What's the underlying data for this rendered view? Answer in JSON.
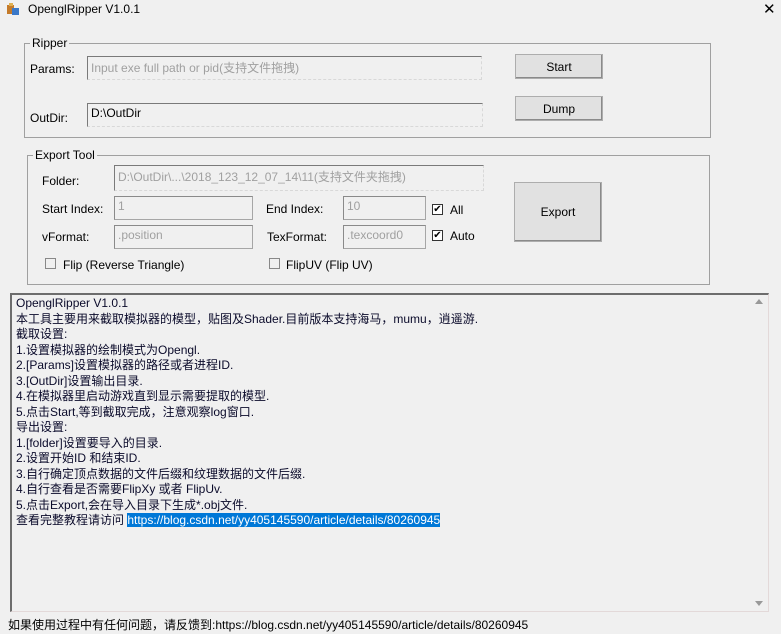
{
  "window": {
    "title": "OpenglRipper V1.0.1",
    "close_icon": "close-icon"
  },
  "ripper": {
    "group_label": "Ripper",
    "params_label": "Params:",
    "params_placeholder": "Input exe full path or pid(支持文件拖拽)",
    "outdir_label": "OutDir:",
    "outdir_value": "D:\\OutDir",
    "start_button": "Start",
    "dump_button": "Dump"
  },
  "export": {
    "group_label": "Export Tool",
    "folder_label": "Folder:",
    "folder_placeholder": "D:\\OutDir\\...\\2018_123_12_07_14\\11(支持文件夹拖拽)",
    "start_index_label": "Start Index:",
    "start_index_value": "1",
    "end_index_label": "End Index:",
    "end_index_value": "10",
    "all_label": "All",
    "all_checked": true,
    "vformat_label": "vFormat:",
    "vformat_value": ".position",
    "texformat_label": "TexFormat:",
    "texformat_value": ".texcoord0",
    "auto_label": "Auto",
    "auto_checked": true,
    "flip_label": "Flip (Reverse Triangle)",
    "flip_checked": false,
    "flipuv_label": "FlipUV (Flip UV)",
    "flipuv_checked": false,
    "export_button": "Export"
  },
  "log": {
    "lines": [
      "OpenglRipper V1.0.1",
      "本工具主要用来截取模拟器的模型，贴图及Shader.目前版本支持海马，mumu，逍遥游.",
      "截取设置:",
      "1.设置模拟器的绘制模式为Opengl.",
      "2.[Params]设置模拟器的路径或者进程ID.",
      "3.[OutDir]设置输出目录.",
      "4.在模拟器里启动游戏直到显示需要提取的模型.",
      "5.点击Start,等到截取完成，注意观察log窗口.",
      "导出设置:",
      "1.[folder]设置要导入的目录.",
      "2.设置开始ID 和结束ID.",
      "3.自行确定顶点数据的文件后缀和纹理数据的文件后缀.",
      "4.自行查看是否需要FlipXy 或者 FlipUv.",
      "5.点击Export,会在导入目录下生成*.obj文件."
    ],
    "last_prefix": "查看完整教程请访问 ",
    "last_link": "https://blog.csdn.net/yy405145590/article/details/80260945"
  },
  "status": "如果使用过程中有任何问题，请反馈到:https://blog.csdn.net/yy405145590/article/details/80260945"
}
